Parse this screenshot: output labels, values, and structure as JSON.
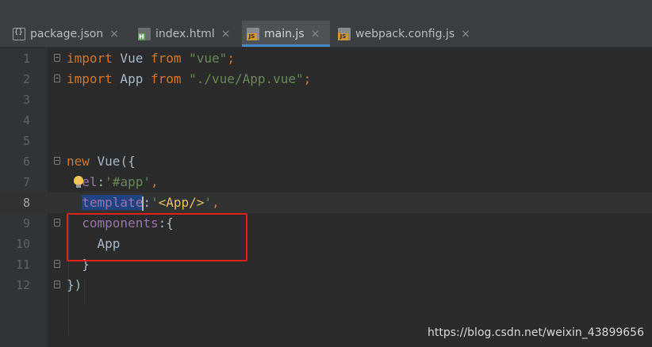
{
  "tabs": [
    {
      "label": "package.json",
      "icon": "json-file-icon",
      "active": false,
      "close": "×"
    },
    {
      "label": "index.html",
      "icon": "html-file-icon",
      "active": false,
      "close": "×"
    },
    {
      "label": "main.js",
      "icon": "js-file-icon",
      "active": true,
      "close": "×"
    },
    {
      "label": "webpack.config.js",
      "icon": "js-file-icon",
      "active": false,
      "close": "×"
    }
  ],
  "lines": [
    {
      "num": "1",
      "fold": "open",
      "tokens": [
        [
          "kw",
          "import"
        ],
        [
          "id",
          " Vue "
        ],
        [
          "kw",
          "from"
        ],
        [
          "id",
          " "
        ],
        [
          "str",
          "\"vue\""
        ],
        [
          "kw",
          ";"
        ]
      ]
    },
    {
      "num": "2",
      "fold": "close",
      "tokens": [
        [
          "kw",
          "import"
        ],
        [
          "id",
          " App "
        ],
        [
          "kw",
          "from"
        ],
        [
          "id",
          " "
        ],
        [
          "str",
          "\"./vue/App.vue\""
        ],
        [
          "kw",
          ";"
        ]
      ]
    },
    {
      "num": "3",
      "fold": "",
      "tokens": []
    },
    {
      "num": "4",
      "fold": "",
      "tokens": []
    },
    {
      "num": "5",
      "fold": "",
      "tokens": []
    },
    {
      "num": "6",
      "fold": "open",
      "tokens": [
        [
          "kw",
          "new"
        ],
        [
          "id",
          " Vue({"
        ]
      ]
    },
    {
      "num": "7",
      "fold": "",
      "tokens": [
        [
          "id",
          "  "
        ],
        [
          "prop",
          "el"
        ],
        [
          "id",
          ":"
        ],
        [
          "str",
          "'#app'"
        ],
        [
          "kw",
          ","
        ]
      ]
    },
    {
      "num": "8",
      "fold": "",
      "current": true,
      "tokens": [
        [
          "id",
          "  "
        ],
        [
          "prop sel",
          "template"
        ],
        [
          "caret",
          ""
        ],
        [
          "id",
          ":"
        ],
        [
          "str",
          "'"
        ],
        [
          "tagstr",
          "<App/>"
        ],
        [
          "str",
          "'"
        ],
        [
          "kw",
          ","
        ]
      ]
    },
    {
      "num": "9",
      "fold": "open",
      "tokens": [
        [
          "id",
          "  "
        ],
        [
          "prop",
          "components"
        ],
        [
          "id",
          ":{"
        ]
      ]
    },
    {
      "num": "10",
      "fold": "",
      "tokens": [
        [
          "id",
          "    App"
        ]
      ]
    },
    {
      "num": "11",
      "fold": "close",
      "tokens": [
        [
          "id",
          "  }"
        ]
      ]
    },
    {
      "num": "12",
      "fold": "close",
      "tokens": [
        [
          "id",
          "})"
        ]
      ]
    }
  ],
  "watermark": "https://blog.csdn.net/weixin_43899656",
  "colors": {
    "keyword": "#cc7832",
    "string": "#6a8759",
    "property": "#9876aa",
    "highlight_box": "#e0201a",
    "selection": "#214283"
  }
}
